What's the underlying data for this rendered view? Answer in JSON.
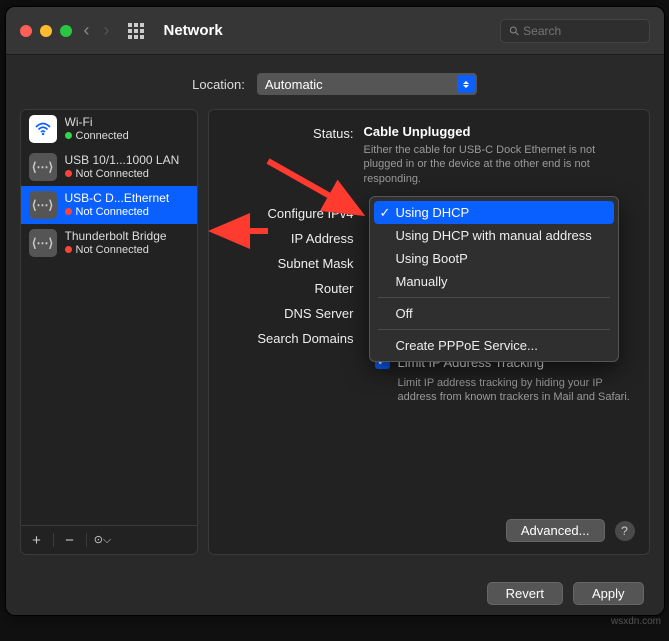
{
  "titlebar": {
    "title": "Network",
    "search_placeholder": "Search"
  },
  "location": {
    "label": "Location:",
    "value": "Automatic"
  },
  "interfaces": [
    {
      "name": "Wi-Fi",
      "status": "Connected",
      "dot": "green",
      "icon": "wifi"
    },
    {
      "name": "USB 10/1...1000 LAN",
      "status": "Not Connected",
      "dot": "red",
      "icon": "ethernet"
    },
    {
      "name": "USB-C D...Ethernet",
      "status": "Not Connected",
      "dot": "red",
      "icon": "ethernet",
      "selected": true
    },
    {
      "name": "Thunderbolt Bridge",
      "status": "Not Connected",
      "dot": "red",
      "icon": "ethernet"
    }
  ],
  "sidebar_foot": {
    "plus": "+",
    "minus": "−",
    "more": "⊙⌵"
  },
  "details": {
    "status_label": "Status:",
    "status_value": "Cable Unplugged",
    "status_note": "Either the cable for USB-C Dock Ethernet is not plugged in or the device at the other end is not responding.",
    "rows": [
      "Configure IPv4",
      "IP Address",
      "Subnet Mask",
      "Router",
      "DNS Server",
      "Search Domains"
    ],
    "limit_label": "Limit IP Address Tracking",
    "limit_note": "Limit IP address tracking by hiding your IP address from known trackers in Mail and Safari."
  },
  "dropdown": {
    "items": [
      "Using DHCP",
      "Using DHCP with manual address",
      "Using BootP",
      "Manually"
    ],
    "off": "Off",
    "pppoe": "Create PPPoE Service..."
  },
  "buttons": {
    "advanced": "Advanced...",
    "revert": "Revert",
    "apply": "Apply",
    "help": "?"
  }
}
